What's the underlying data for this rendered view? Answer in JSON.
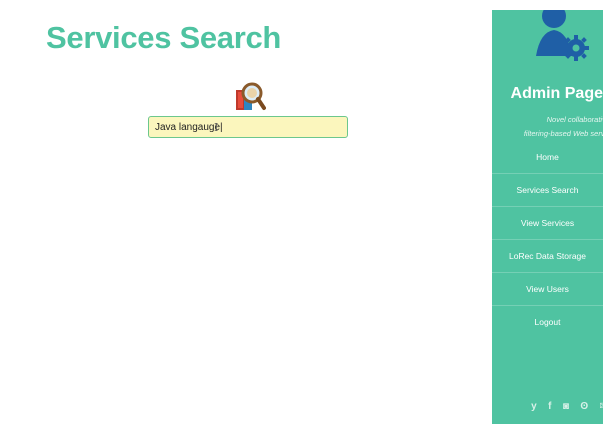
{
  "main": {
    "title": "Services Search",
    "search": {
      "value": "Java langauge|",
      "cursor": "I"
    }
  },
  "sidebar": {
    "title": "Admin Page",
    "subtitle_line1": "Novel collaborative",
    "subtitle_line2": "filtering-based Web servic",
    "items": [
      {
        "label": "Home"
      },
      {
        "label": "Services Search"
      },
      {
        "label": "View Services"
      },
      {
        "label": "LoRec Data Storage"
      },
      {
        "label": "View Users"
      },
      {
        "label": "Logout"
      }
    ],
    "social": [
      {
        "icon": "twitter-icon",
        "glyph": "y"
      },
      {
        "icon": "facebook-icon",
        "glyph": "f"
      },
      {
        "icon": "instagram-icon",
        "glyph": "◙"
      },
      {
        "icon": "github-icon",
        "glyph": "ʘ"
      },
      {
        "icon": "email-icon",
        "glyph": "✉"
      }
    ]
  },
  "colors": {
    "accent": "#4fc3a1",
    "avatar": "#1f5fa6",
    "input_bg": "#fbf6bd",
    "input_border": "#6cc78d"
  }
}
